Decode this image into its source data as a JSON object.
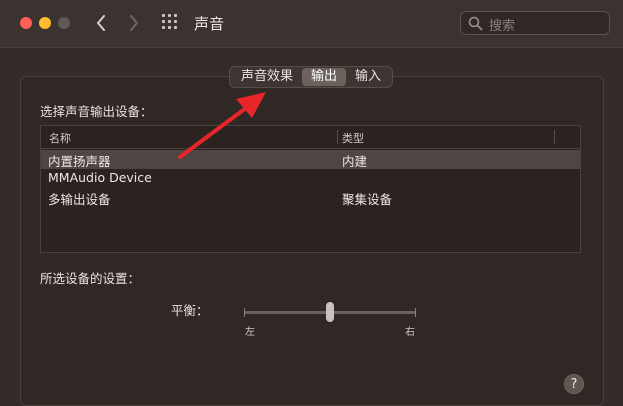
{
  "window": {
    "title": "声音",
    "search_placeholder": "搜索"
  },
  "tabs": [
    {
      "label": "声音效果",
      "active": false
    },
    {
      "label": "输出",
      "active": true
    },
    {
      "label": "输入",
      "active": false
    }
  ],
  "output": {
    "section_label": "选择声音输出设备：",
    "columns": [
      "名称",
      "类型"
    ],
    "devices": [
      {
        "name": "内置扬声器",
        "type": "内建",
        "selected": true
      },
      {
        "name": "MMAudio Device",
        "type": "",
        "selected": false
      },
      {
        "name": "多输出设备",
        "type": "聚集设备",
        "selected": false
      }
    ]
  },
  "settings": {
    "section_label": "所选设备的设置：",
    "balance_label": "平衡：",
    "balance_left": "左",
    "balance_right": "右",
    "balance_value": 0.5
  },
  "help_label": "?",
  "colors": {
    "accent_arrow": "#e8262a",
    "selected_row": "#4e4642",
    "close": "#fe5f57",
    "minimize": "#febc2e"
  },
  "icons": [
    "back-chevron-icon",
    "forward-chevron-icon",
    "grid-icon",
    "search-icon"
  ]
}
